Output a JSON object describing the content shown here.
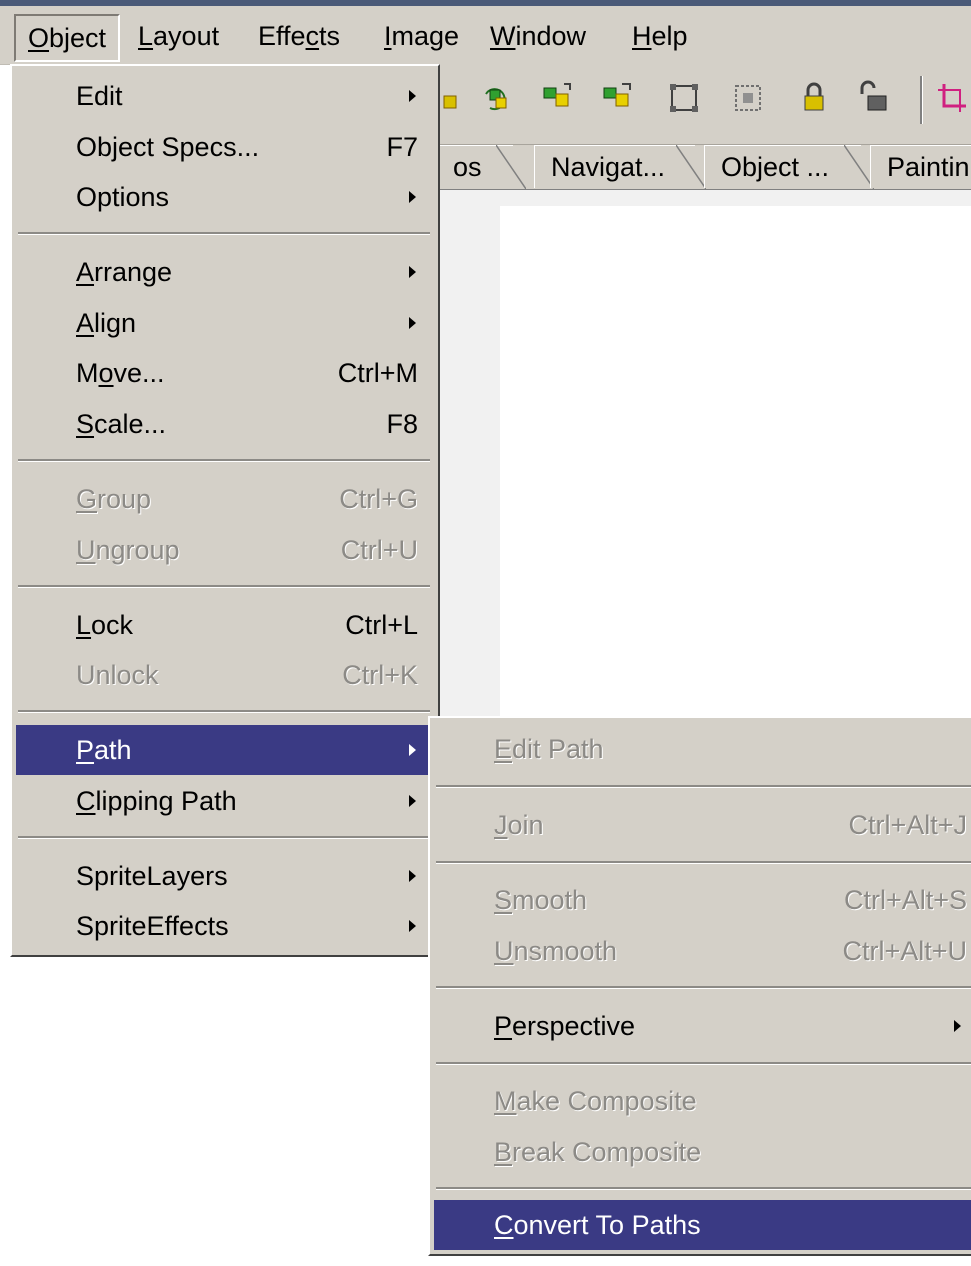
{
  "menubar": {
    "items": [
      {
        "name": "object",
        "pre": "",
        "ul": "O",
        "post": "bject"
      },
      {
        "name": "layout",
        "pre": "",
        "ul": "L",
        "post": "ayout"
      },
      {
        "name": "effects",
        "pre": "Effe",
        "ul": "c",
        "post": "ts"
      },
      {
        "name": "image",
        "pre": "",
        "ul": "I",
        "post": "mage"
      },
      {
        "name": "window",
        "pre": "",
        "ul": "W",
        "post": "indow"
      },
      {
        "name": "help",
        "pre": "",
        "ul": "H",
        "post": "elp"
      }
    ]
  },
  "tabs": [
    "os",
    "Navigat...",
    "Object ...",
    "Paintin"
  ],
  "object_menu": {
    "items": [
      {
        "pre": "Edit",
        "ul": "",
        "post": "",
        "shortcut": "",
        "submenu": true,
        "state": "enabled"
      },
      {
        "pre": "Object Specs...",
        "ul": "",
        "post": "",
        "shortcut": "F7",
        "submenu": false,
        "state": "enabled"
      },
      {
        "pre": "Options",
        "ul": "",
        "post": "",
        "shortcut": "",
        "submenu": true,
        "state": "enabled"
      },
      {
        "pre": "",
        "ul": "A",
        "post": "rrange",
        "shortcut": "",
        "submenu": true,
        "state": "enabled"
      },
      {
        "pre": "",
        "ul": "A",
        "post": "lign",
        "shortcut": "",
        "submenu": true,
        "state": "enabled"
      },
      {
        "pre": "M",
        "ul": "o",
        "post": "ve...",
        "shortcut": "Ctrl+M",
        "submenu": false,
        "state": "enabled"
      },
      {
        "pre": "",
        "ul": "S",
        "post": "cale...",
        "shortcut": "F8",
        "submenu": false,
        "state": "enabled"
      },
      {
        "pre": "",
        "ul": "G",
        "post": "roup",
        "shortcut": "Ctrl+G",
        "submenu": false,
        "state": "disabled"
      },
      {
        "pre": "",
        "ul": "U",
        "post": "ngroup",
        "shortcut": "Ctrl+U",
        "submenu": false,
        "state": "disabled"
      },
      {
        "pre": "",
        "ul": "L",
        "post": "ock",
        "shortcut": "Ctrl+L",
        "submenu": false,
        "state": "enabled"
      },
      {
        "pre": "Unlock",
        "ul": "",
        "post": "",
        "shortcut": "Ctrl+K",
        "submenu": false,
        "state": "disabled"
      },
      {
        "pre": "",
        "ul": "P",
        "post": "ath",
        "shortcut": "",
        "submenu": true,
        "state": "selected"
      },
      {
        "pre": "",
        "ul": "C",
        "post": "lipping Path",
        "shortcut": "",
        "submenu": true,
        "state": "enabled"
      },
      {
        "pre": "SpriteLayers",
        "ul": "",
        "post": "",
        "shortcut": "",
        "submenu": true,
        "state": "enabled"
      },
      {
        "pre": "SpriteEffects",
        "ul": "",
        "post": "",
        "shortcut": "",
        "submenu": true,
        "state": "enabled"
      }
    ]
  },
  "path_menu": {
    "items": [
      {
        "pre": "",
        "ul": "E",
        "post": "dit Path",
        "shortcut": "",
        "submenu": false,
        "state": "disabled"
      },
      {
        "pre": "",
        "ul": "J",
        "post": "oin",
        "shortcut": "Ctrl+Alt+J",
        "submenu": false,
        "state": "disabled"
      },
      {
        "pre": "",
        "ul": "S",
        "post": "mooth",
        "shortcut": "Ctrl+Alt+S",
        "submenu": false,
        "state": "disabled"
      },
      {
        "pre": "",
        "ul": "U",
        "post": "nsmooth",
        "shortcut": "Ctrl+Alt+U",
        "submenu": false,
        "state": "disabled"
      },
      {
        "pre": "",
        "ul": "P",
        "post": "erspective",
        "shortcut": "",
        "submenu": true,
        "state": "enabled"
      },
      {
        "pre": "",
        "ul": "M",
        "post": "ake Composite",
        "shortcut": "",
        "submenu": false,
        "state": "disabled"
      },
      {
        "pre": "",
        "ul": "B",
        "post": "reak Composite",
        "shortcut": "",
        "submenu": false,
        "state": "disabled"
      },
      {
        "pre": "",
        "ul": "C",
        "post": "onvert To Paths",
        "shortcut": "",
        "submenu": false,
        "state": "selected"
      }
    ]
  },
  "toolbar": {
    "icons": [
      "group-arrange-icon",
      "rotate-object-icon",
      "align-objects-icon",
      "distribute-objects-icon",
      "grid-select-icon",
      "grid-deselect-icon",
      "lock-icon",
      "unlock-icon",
      "crop-icon"
    ]
  },
  "colors": {
    "face": "#d4d0c8",
    "highlight": "#3a3a84",
    "disabled_text": "#8c8a86",
    "window_border": "#4a5a78"
  }
}
